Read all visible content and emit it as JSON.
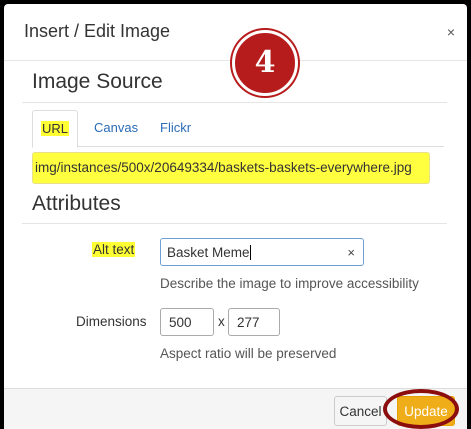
{
  "dialog": {
    "title": "Insert / Edit Image",
    "close_glyph": "×",
    "step_number": "4"
  },
  "image_source": {
    "heading": "Image Source",
    "tabs": [
      {
        "label": "URL",
        "active": true,
        "highlighted": true
      },
      {
        "label": "Canvas",
        "active": false
      },
      {
        "label": "Flickr",
        "active": false
      }
    ],
    "url_value": "img/instances/500x/20649334/baskets-baskets-everywhere.jpg"
  },
  "attributes": {
    "heading": "Attributes",
    "alt_text_label": "Alt text",
    "alt_text_value": "Basket Meme",
    "alt_clear_glyph": "×",
    "alt_help": "Describe the image to improve accessibility",
    "dimensions_label": "Dimensions",
    "width_value": "500",
    "times_glyph": "x",
    "height_value": "277",
    "aspect_note": "Aspect ratio will be preserved"
  },
  "footer": {
    "cancel_label": "Cancel",
    "update_label": "Update"
  },
  "colors": {
    "highlight": "#ffff40",
    "annotation_red": "#b71c1c",
    "update_button": "#f0ad1a",
    "link_blue": "#2a6cb6"
  },
  "icons": {
    "close": "close-icon",
    "clear": "clear-icon"
  }
}
